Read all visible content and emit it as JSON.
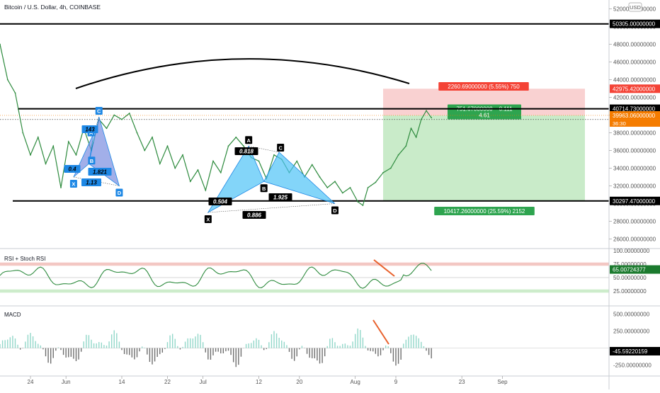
{
  "header": {
    "symbol_title": "Bitcoin / U.S. Dollar, 4h, COINBASE",
    "currency_badge": "USD"
  },
  "colors": {
    "price_line": "#2e8b3e",
    "harmonic_fill": "#4fc3f7",
    "harmonic_fill_small": "#7b8de0",
    "label_blue": "#1e88e5",
    "stop_zone": "#f8c9c9",
    "target_zone": "#bfe8c0",
    "stop_badge": "#f44336",
    "target_badge": "#2ea44f",
    "current_price_badge": "#f57c00",
    "rsi_upper_band": "#f2c1bd",
    "rsi_lower_band": "#c8eac5",
    "divergence_line": "#e8612c"
  },
  "chart_data": {
    "type": "line",
    "x_ticks": [
      "24",
      "Jun",
      "14",
      "22",
      "Jul",
      "12",
      "20",
      "Aug",
      "9",
      "23",
      "Sep"
    ],
    "price_axis": {
      "ylim": [
        25000,
        53000
      ],
      "ticks": [
        "52000.00000000",
        "50000.00000000",
        "48000.00000000",
        "46000.00000000",
        "44000.00000000",
        "42000.00000000",
        "40000.00000000",
        "38000.00000000",
        "36000.00000000",
        "34000.00000000",
        "32000.00000000",
        "30000.00000000",
        "28000.00000000",
        "26000.00000000"
      ],
      "tick_values": [
        52000,
        50000,
        48000,
        46000,
        44000,
        42000,
        40000,
        38000,
        36000,
        34000,
        32000,
        30000,
        28000,
        26000
      ],
      "price_series": [
        {
          "x": 0,
          "y": 48000
        },
        {
          "x": 3,
          "y": 44000
        },
        {
          "x": 6,
          "y": 42500
        },
        {
          "x": 9,
          "y": 38000
        },
        {
          "x": 12,
          "y": 35500
        },
        {
          "x": 15,
          "y": 37500
        },
        {
          "x": 18,
          "y": 34500
        },
        {
          "x": 21,
          "y": 36500
        },
        {
          "x": 24,
          "y": 31800
        },
        {
          "x": 27,
          "y": 37000
        },
        {
          "x": 30,
          "y": 35500
        },
        {
          "x": 33,
          "y": 38500
        },
        {
          "x": 36,
          "y": 36000
        },
        {
          "x": 39,
          "y": 39500
        },
        {
          "x": 42,
          "y": 38500
        },
        {
          "x": 45,
          "y": 40000
        },
        {
          "x": 48,
          "y": 39500
        },
        {
          "x": 51,
          "y": 40200
        },
        {
          "x": 54,
          "y": 38000
        },
        {
          "x": 57,
          "y": 36000
        },
        {
          "x": 60,
          "y": 37500
        },
        {
          "x": 63,
          "y": 34500
        },
        {
          "x": 66,
          "y": 36500
        },
        {
          "x": 69,
          "y": 34000
        },
        {
          "x": 72,
          "y": 35500
        },
        {
          "x": 75,
          "y": 32500
        },
        {
          "x": 78,
          "y": 33800
        },
        {
          "x": 81,
          "y": 31500
        },
        {
          "x": 84,
          "y": 34800
        },
        {
          "x": 87,
          "y": 33500
        },
        {
          "x": 90,
          "y": 36500
        },
        {
          "x": 93,
          "y": 37500
        },
        {
          "x": 96,
          "y": 36500
        },
        {
          "x": 99,
          "y": 35200
        },
        {
          "x": 102,
          "y": 34800
        },
        {
          "x": 105,
          "y": 32800
        },
        {
          "x": 108,
          "y": 35500
        },
        {
          "x": 111,
          "y": 35000
        },
        {
          "x": 114,
          "y": 33500
        },
        {
          "x": 117,
          "y": 34800
        },
        {
          "x": 120,
          "y": 33000
        },
        {
          "x": 123,
          "y": 34400
        },
        {
          "x": 126,
          "y": 33000
        },
        {
          "x": 129,
          "y": 31800
        },
        {
          "x": 132,
          "y": 32500
        },
        {
          "x": 135,
          "y": 31200
        },
        {
          "x": 138,
          "y": 31800
        },
        {
          "x": 141,
          "y": 30200
        },
        {
          "x": 143,
          "y": 29800
        },
        {
          "x": 145,
          "y": 31800
        },
        {
          "x": 148,
          "y": 32400
        },
        {
          "x": 151,
          "y": 33500
        },
        {
          "x": 154,
          "y": 34000
        },
        {
          "x": 157,
          "y": 35500
        },
        {
          "x": 160,
          "y": 36500
        },
        {
          "x": 162,
          "y": 38500
        },
        {
          "x": 164,
          "y": 37500
        },
        {
          "x": 166,
          "y": 39500
        },
        {
          "x": 168,
          "y": 40500
        },
        {
          "x": 170,
          "y": 39700
        }
      ],
      "annotations": {
        "resistance_line": 40714.73,
        "support_line": 30297.47,
        "top_line": 50305.0,
        "stop_level": 42975.42,
        "entry_level": 39963.06,
        "dotted_level": 39500,
        "stop_label": "2260.69000000 (5.55%) 750",
        "entry_label_1": "751.67000000 ~ 0.111",
        "entry_label_2": "4.61",
        "target_label": "10417.26000000 (25.59%) 2152"
      },
      "price_badges": [
        {
          "text": "50305.00000000",
          "value": 50305.0,
          "kind": "line"
        },
        {
          "text": "42975.42000000",
          "value": 42975.42,
          "kind": "stop"
        },
        {
          "text": "40714.73000000",
          "value": 40714.73,
          "kind": "line"
        },
        {
          "text": "39963.06000000",
          "value": 39963.06,
          "kind": "current"
        },
        {
          "text": "30297.47000000",
          "value": 30297.47,
          "kind": "line"
        }
      ],
      "current_countdown": "36:30"
    },
    "harmonic_large": {
      "points": [
        {
          "label": "X",
          "x": 82,
          "y": 29000
        },
        {
          "label": "A",
          "x": 98,
          "y": 36500
        },
        {
          "label": "B",
          "x": 104,
          "y": 32500
        },
        {
          "label": "C",
          "x": 110,
          "y": 35800
        },
        {
          "label": "D",
          "x": 132,
          "y": 30000
        }
      ],
      "ratios": [
        "0.504",
        "0.818",
        "1.925",
        "0.886"
      ]
    },
    "harmonic_small": {
      "points": [
        {
          "label": "X",
          "x": 29,
          "y": 33000
        },
        {
          "label": "A",
          "x": 37,
          "y": 38000
        },
        {
          "label": "B",
          "x": 35,
          "y": 34500
        },
        {
          "label": "C",
          "x": 39,
          "y": 39800
        },
        {
          "label": "D",
          "x": 47,
          "y": 32000
        }
      ],
      "ratios": [
        "143",
        "0.4",
        "1.821",
        "1.13"
      ]
    },
    "rsi": {
      "title": "RSI + Stoch RSI",
      "ylim": [
        0,
        100
      ],
      "ticks": [
        "100.00000000",
        "75.00000000",
        "50.00000000",
        "25.00000000"
      ],
      "tick_values": [
        100,
        75,
        50,
        25
      ],
      "current": "65.00724377",
      "current_value": 65.00724377
    },
    "macd": {
      "title": "MACD",
      "ylim": [
        -400,
        600
      ],
      "ticks": [
        "500.00000000",
        "250.00000000",
        "-250.00000000"
      ],
      "tick_values": [
        500,
        250,
        -250
      ],
      "current": "-45.59220159",
      "current_value": -45.59220159
    }
  }
}
